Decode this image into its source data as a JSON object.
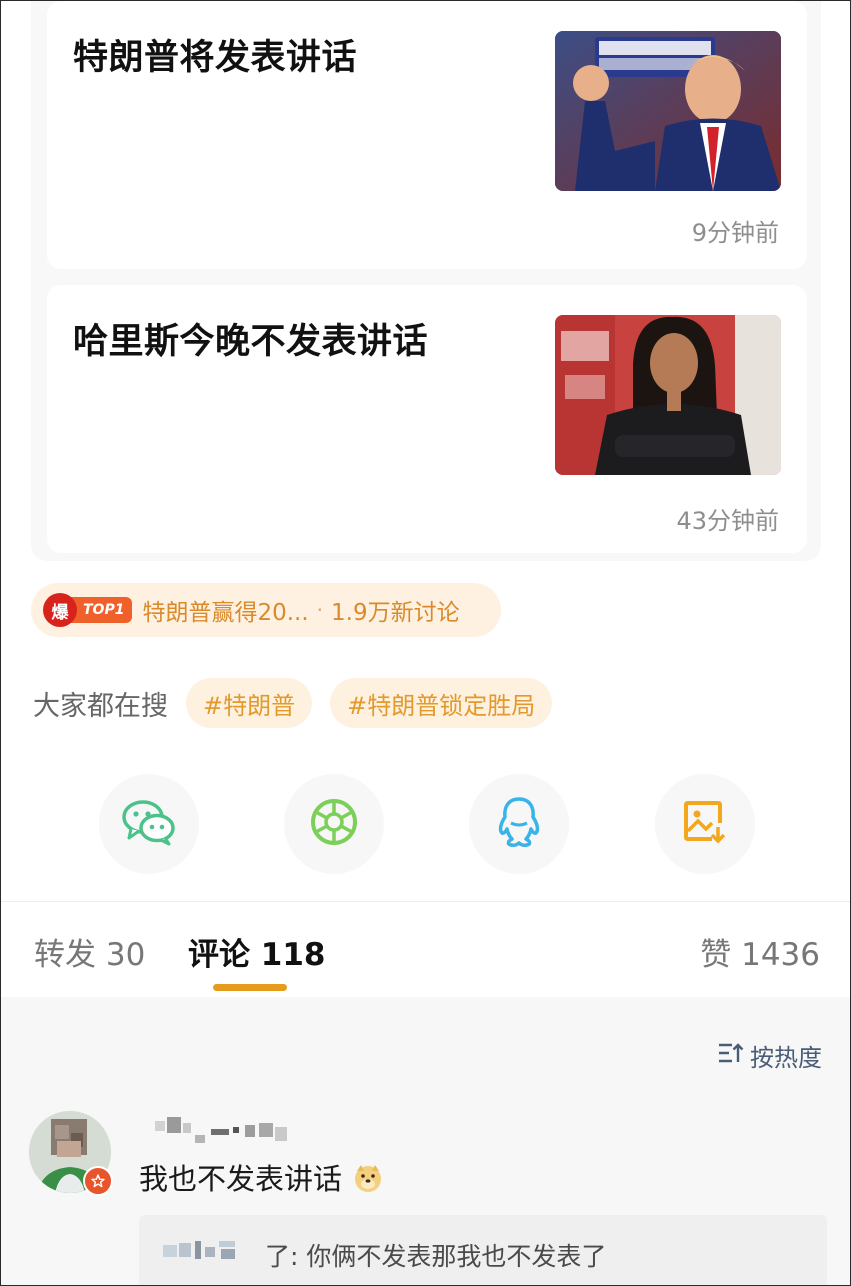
{
  "news": [
    {
      "title": "特朗普将发表讲话",
      "time": "9分钟前",
      "thumb_icon": "trump-photo"
    },
    {
      "title": "哈里斯今晚不发表讲话",
      "time": "43分钟前",
      "thumb_icon": "harris-photo"
    }
  ],
  "hot": {
    "badge": "爆",
    "rank": "TOP1",
    "topic": "特朗普赢得20...",
    "separator": "·",
    "discussion": "1.9万新讨论"
  },
  "search": {
    "label": "大家都在搜",
    "tags": [
      "#特朗普",
      "#特朗普锁定胜局"
    ]
  },
  "share": {
    "icons": [
      "wechat-icon",
      "moments-icon",
      "qq-icon",
      "save-image-icon"
    ]
  },
  "tabs": {
    "repost": "转发 30",
    "comments": "评论 118",
    "likes": "赞 1436"
  },
  "comments": {
    "sort_label": "按热度",
    "items": [
      {
        "text": "我也不发表讲话",
        "reply_suffix": "了: 你俩不发表那我也不发表了"
      }
    ]
  },
  "colors": {
    "accent": "#e59b1c",
    "tag_text": "#e29a2c",
    "tag_bg": "#fff1e0",
    "wechat": "#4cc28b",
    "moments": "#7ccf58",
    "qq": "#3ab3e8",
    "save": "#f2a71f"
  }
}
